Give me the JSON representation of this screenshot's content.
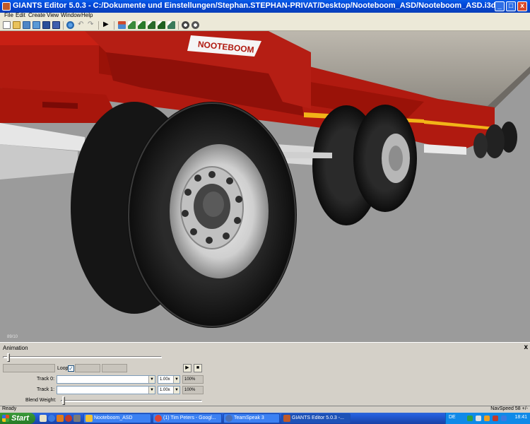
{
  "window": {
    "title": "GIANTS Editor 5.0.3 - C:/Dokumente und Einstellungen/Stephan.STEPHAN-PRIVAT/Desktop/Nooteboom_ASD/Nooteboom_ASD.i3d",
    "minimize": "_",
    "maximize": "□",
    "close": "x"
  },
  "menu": [
    "File",
    "Edit",
    "Create",
    "View",
    "Window",
    "Help"
  ],
  "toolbar": {
    "icons": [
      "new-file-icon",
      "open-icon",
      "import-icon",
      "export-icon",
      "save-icon",
      "save-as-icon",
      "refresh-icon",
      "undo-icon",
      "redo-icon",
      "play-icon",
      "home-icon",
      "terrain-icon",
      "terrain-paint-icon",
      "foliage-icon",
      "grass-icon",
      "record-icon",
      "render-icon"
    ]
  },
  "viewport": {
    "logo_text": "NOOTEBOOM",
    "coordinates": "89/10"
  },
  "animation": {
    "title": "Animation",
    "close": "x",
    "loop_label": "Loop",
    "loop_checked": "✓",
    "play_label": "▶",
    "stop_label": "■",
    "tracks": [
      {
        "label": "Track 0:",
        "speed": "1.00x",
        "weight": "100%"
      },
      {
        "label": "Track 1:",
        "speed": "1.00x",
        "weight": "100%"
      }
    ],
    "blend_label": "Blend Weight:"
  },
  "status": {
    "text": "Ready",
    "nav_speed": "NavSpeed 58 +/-"
  },
  "taskbar": {
    "start": "Start",
    "tasks": [
      {
        "label": "Nooteboom_ASD",
        "icon_color": "#f1c232"
      },
      {
        "label": "(1) Tim Peters - Googl...",
        "icon_color": "#db4437"
      },
      {
        "label": "TeamSpeak 3",
        "icon_color": "#4a6fb5"
      },
      {
        "label": "GIANTS Editor 5.0.3 -...",
        "icon_color": "#c05a2a",
        "active": true
      }
    ],
    "language": "DE",
    "clock": "18:41"
  }
}
